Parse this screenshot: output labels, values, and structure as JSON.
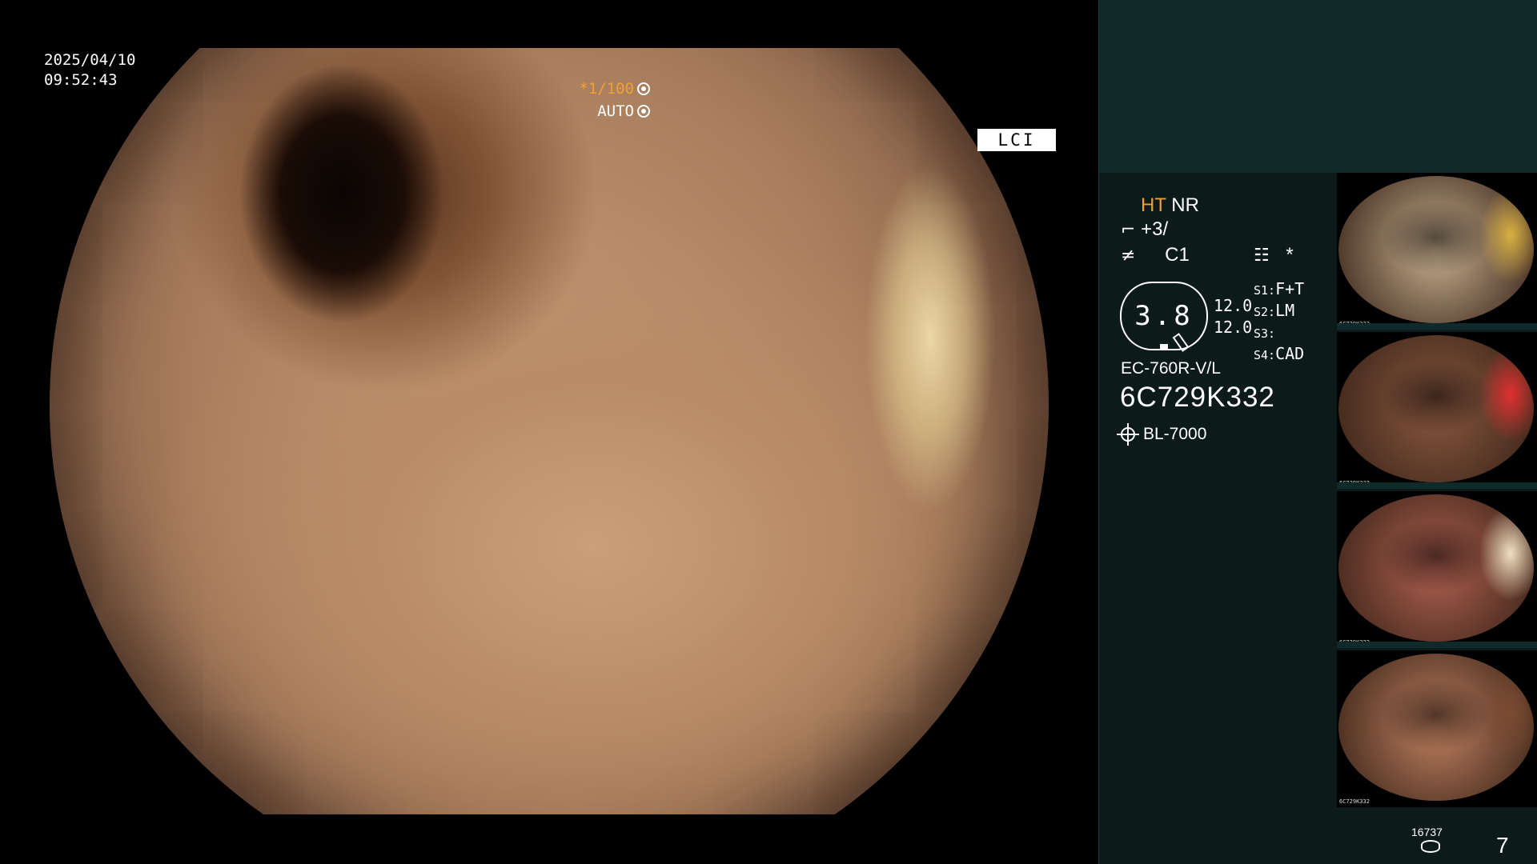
{
  "scope": {
    "date": "2025/04/10",
    "time": "09:52:43",
    "shutter": "*1/100",
    "exposure": "AUTO",
    "mode_label": "LCI"
  },
  "panel": {
    "ht_label": "HT",
    "nr_label": "NR",
    "enhance": "+3/",
    "color_mode": "C1",
    "star_mark": "*",
    "gauge_value": "3.8",
    "gauge_side_top": "12.0",
    "gauge_side_bottom": "12.0",
    "settings": [
      {
        "key": "S1:",
        "value": "F+T"
      },
      {
        "key": "S2:",
        "value": "LM"
      },
      {
        "key": "S3:",
        "value": ""
      },
      {
        "key": "S4:",
        "value": "CAD"
      }
    ],
    "scope_model": "EC-760R-V/L",
    "serial": "6C729K332",
    "light_source": "BL-7000",
    "image_count": "16737",
    "capture_count": "7"
  },
  "thumbnails": [
    {
      "id": "1",
      "caption": "6C729K332",
      "tone": "#c8b090",
      "accent": "#d8b040"
    },
    {
      "id": "2",
      "caption": "6C729K332",
      "tone": "#8a5840",
      "accent": "#e03030"
    },
    {
      "id": "3",
      "caption": "6C729K332",
      "tone": "#b06050",
      "accent": "#f0e0c0"
    },
    {
      "id": "4",
      "caption": "6C729K332",
      "tone": "#c08060",
      "accent": "#7a4a30"
    }
  ]
}
